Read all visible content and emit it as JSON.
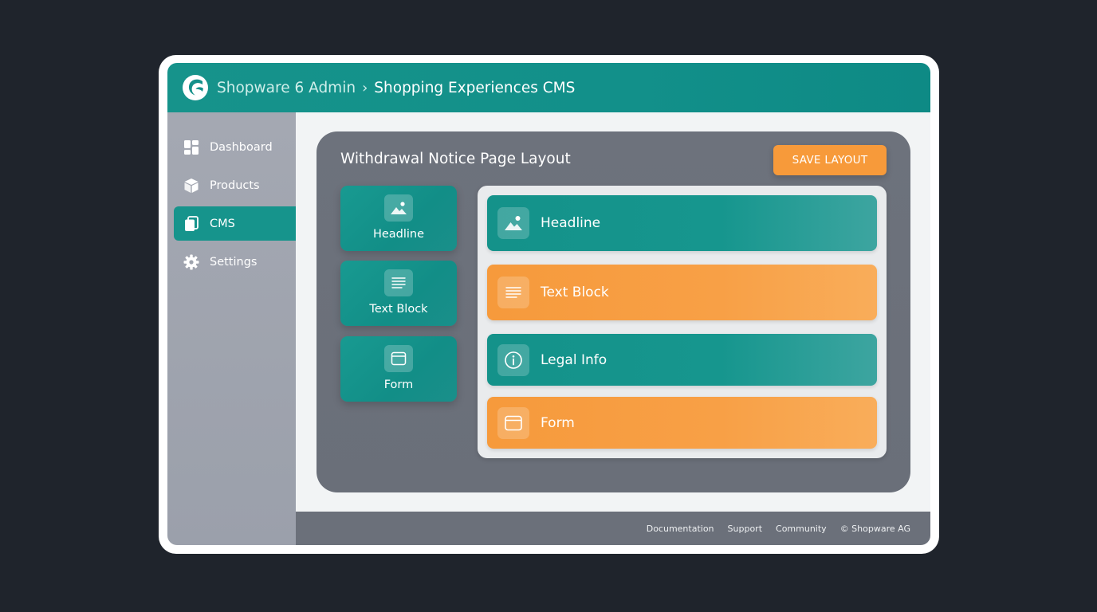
{
  "header": {
    "app_name": "Shopware 6 Admin",
    "separator": "›",
    "page_name": "Shopping Experiences CMS"
  },
  "sidebar": {
    "items": [
      {
        "label": "Dashboard",
        "icon": "dashboard-icon",
        "active": false
      },
      {
        "label": "Products",
        "icon": "box-icon",
        "active": false
      },
      {
        "label": "CMS",
        "icon": "pages-icon",
        "active": true
      },
      {
        "label": "Settings",
        "icon": "gear-icon",
        "active": false
      }
    ]
  },
  "editor": {
    "title": "Withdrawal Notice Page Layout",
    "save_label": "SAVE LAYOUT",
    "palette": [
      {
        "label": "Headline",
        "icon": "image-icon"
      },
      {
        "label": "Text Block",
        "icon": "text-lines-icon"
      },
      {
        "label": "Form",
        "icon": "form-window-icon"
      }
    ],
    "blocks": [
      {
        "label": "Headline",
        "icon": "image-icon",
        "color": "teal"
      },
      {
        "label": "Text Block",
        "icon": "text-lines-icon",
        "color": "orange"
      },
      {
        "label": "Legal Info",
        "icon": "info-icon",
        "color": "teal"
      },
      {
        "label": "Form",
        "icon": "form-window-icon",
        "color": "orange"
      }
    ]
  },
  "footer": {
    "links": [
      "Documentation",
      "Support",
      "Community",
      "© Shopware AG"
    ]
  },
  "colors": {
    "brand_teal": "#16948c",
    "accent_orange": "#f79a3a",
    "background": "#1f242c"
  }
}
